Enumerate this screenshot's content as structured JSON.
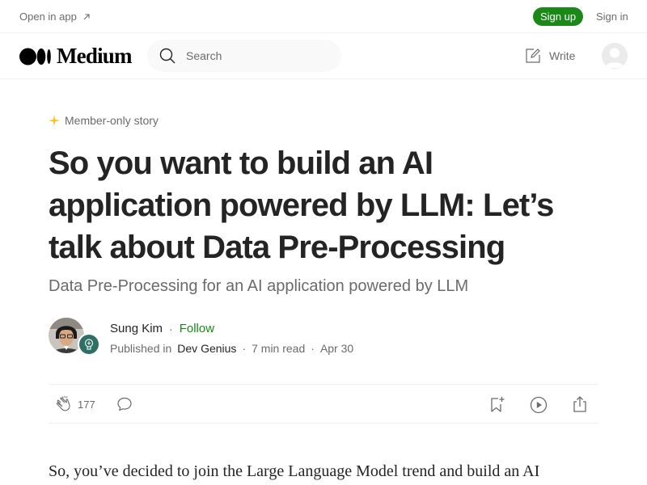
{
  "topbar": {
    "open_in_app": "Open in app",
    "sign_up": "Sign up",
    "sign_in": "Sign in"
  },
  "header": {
    "logo_text": "Medium",
    "search_placeholder": "Search",
    "write_label": "Write"
  },
  "article": {
    "badge": "Member-only story",
    "title": "So you want to build an AI application powered by LLM: Let’s talk about Data Pre-Processing",
    "subtitle": "Data Pre-Processing for an AI application powered by LLM",
    "author_name": "Sung Kim",
    "follow_label": "Follow",
    "published_in": "Published in",
    "publication": "Dev Genius",
    "read_time": "7 min read",
    "date": "Apr 30",
    "separator": "·",
    "clap_count": "177",
    "body_first_line": "So, you’ve decided to join the Large Language Model trend and build an AI"
  },
  "colors": {
    "accent_green": "#1a8917",
    "star_gold": "#ffc017",
    "text_primary": "#242424",
    "text_secondary": "#6b6b6b"
  },
  "icons": [
    "external-arrow-icon",
    "medium-logo-icon",
    "search-icon",
    "write-icon",
    "user-avatar-icon",
    "star-icon",
    "clap-icon",
    "comment-icon",
    "bookmark-add-icon",
    "play-icon",
    "share-icon"
  ]
}
